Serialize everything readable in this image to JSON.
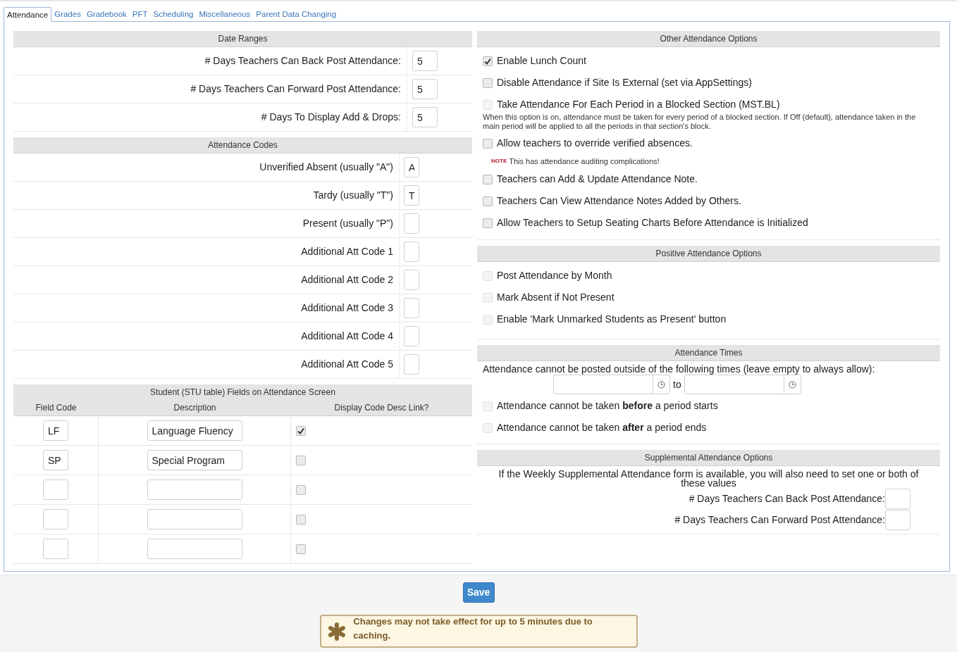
{
  "tabs": [
    {
      "label": "Attendance",
      "selected": true
    },
    {
      "label": "Grades",
      "selected": false
    },
    {
      "label": "Gradebook",
      "selected": false
    },
    {
      "label": "PFT",
      "selected": false
    },
    {
      "label": "Scheduling",
      "selected": false
    },
    {
      "label": "Miscellaneous",
      "selected": false
    },
    {
      "label": "Parent Data Changing",
      "selected": false
    }
  ],
  "date_ranges": {
    "title": "Date Ranges",
    "rows": [
      {
        "label": "# Days Teachers Can Back Post Attendance:",
        "value": "5"
      },
      {
        "label": "# Days Teachers Can Forward Post Attendance:",
        "value": "5"
      },
      {
        "label": "# Days To Display Add & Drops:",
        "value": "5"
      }
    ]
  },
  "attendance_codes": {
    "title": "Attendance Codes",
    "rows": [
      {
        "label": "Unverified Absent (usually \"A\")",
        "value": "A"
      },
      {
        "label": "Tardy (usually \"T\")",
        "value": "T"
      },
      {
        "label": "Present (usually \"P\")"
      },
      {
        "label": "Additional Att Code 1"
      },
      {
        "label": "Additional Att Code 2"
      },
      {
        "label": "Additional Att Code 3"
      },
      {
        "label": "Additional Att Code 4"
      },
      {
        "label": "Additional Att Code 5"
      }
    ]
  },
  "student_fields": {
    "title": "Student (STU table) Fields on Attendance Screen",
    "columns": [
      "Field Code",
      "Description",
      "Display Code Desc Link?"
    ],
    "rows": [
      {
        "field_code": "LF",
        "description": "Language Fluency",
        "display_link": true
      },
      {
        "field_code": "SP",
        "description": "Special Program",
        "display_link": false
      },
      {
        "display_link": false
      },
      {
        "display_link": false
      },
      {
        "display_link": false
      }
    ]
  },
  "other_options": {
    "title": "Other Attendance Options",
    "items": [
      {
        "kind": "checkbox",
        "label": "Enable Lunch Count",
        "checked": true,
        "disabled": false
      },
      {
        "kind": "checkbox",
        "label": "Disable Attendance if Site Is External (set via AppSettings)",
        "checked": false,
        "disabled": false
      },
      {
        "kind": "checkbox",
        "label": "Take Attendance For Each Period in a Blocked Section (MST.BL)",
        "checked": false,
        "disabled": true
      },
      {
        "kind": "help",
        "text": "When this option is on, attendance must be taken for every period of a blocked section. If Off (default), attendance taken in the main period will be applied to all the periods in that section's block."
      },
      {
        "kind": "checkbox",
        "label": "Allow teachers to override verified absences.",
        "checked": false,
        "disabled": false
      },
      {
        "kind": "note",
        "tag": "NOTE",
        "text": "This has attendance auditing complications!"
      },
      {
        "kind": "checkbox",
        "label": "Teachers can Add & Update Attendance Note.",
        "checked": false,
        "disabled": false
      },
      {
        "kind": "checkbox",
        "label": "Teachers Can View Attendance Notes Added by Others.",
        "checked": false,
        "disabled": false
      },
      {
        "kind": "checkbox",
        "label": "Allow Teachers to Setup Seating Charts Before Attendance is Initialized",
        "checked": false,
        "disabled": false
      }
    ]
  },
  "positive_options": {
    "title": "Positive Attendance Options",
    "items": [
      {
        "kind": "checkbox",
        "label": "Post Attendance by Month",
        "checked": false,
        "disabled": true
      },
      {
        "kind": "checkbox",
        "label": "Mark Absent if Not Present",
        "checked": false,
        "disabled": true
      },
      {
        "kind": "checkbox",
        "label": "Enable 'Mark Unmarked Students as Present' button",
        "checked": false,
        "disabled": true
      }
    ]
  },
  "attendance_times": {
    "title": "Attendance Times",
    "instruction": "Attendance cannot be posted outside of the following times (leave empty to always allow):",
    "to_label": "to",
    "items": [
      {
        "kind": "checkbox",
        "label": "Attendance cannot be taken **before** a period starts",
        "checked": false,
        "disabled": true
      },
      {
        "kind": "checkbox",
        "label": "Attendance cannot be taken **after** a period ends",
        "checked": false,
        "disabled": true
      }
    ]
  },
  "supplemental": {
    "title": "Supplemental Attendance Options",
    "text": "If the Weekly Supplemental Attendance form is available, you will also need to set one or both of these values",
    "fields": [
      {
        "label": "# Days Teachers Can Back Post Attendance:"
      },
      {
        "label": "# Days Teachers Can Forward Post Attendance:"
      }
    ]
  },
  "save_button": "Save",
  "notice": "Changes may not take effect for up to 5 minutes due to caching."
}
